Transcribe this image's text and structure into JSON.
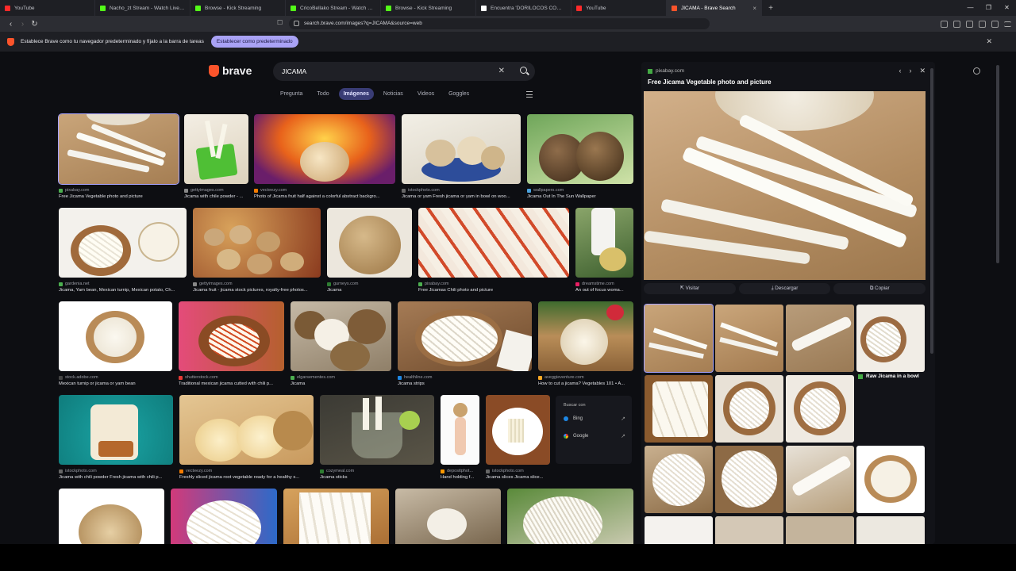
{
  "tabs": [
    {
      "label": "YouTube",
      "color": "#ff2a2a"
    },
    {
      "label": "Nacho_zt Stream - Watch Live on Kick",
      "color": "#53fc18"
    },
    {
      "label": "Browse - Kick Streaming",
      "color": "#53fc18"
    },
    {
      "label": "CricoBellako Stream - Watch Live on Kick",
      "color": "#53fc18"
    },
    {
      "label": "Browse - Kick Streaming",
      "color": "#53fc18"
    },
    {
      "label": "Encuentra 'DORILOCOS COMX' en TikTok",
      "color": "#ffffff"
    },
    {
      "label": "YouTube",
      "color": "#ff2a2a"
    },
    {
      "label": "JICAMA - Brave Search",
      "color": "#fb542b",
      "active": true
    }
  ],
  "url": "search.brave.com/images?q=JICAMA&source=web",
  "infobar": {
    "text": "Establece Brave como tu navegador predeterminado y fíjalo a la barra de tareas",
    "button": "Establecer como predeterminado"
  },
  "brand": "brave",
  "search": {
    "query": "JICAMA"
  },
  "nav": [
    "Pregunta",
    "Todo",
    "Imágenes",
    "Noticias",
    "Videos",
    "Goggles"
  ],
  "nav_selected": "Imágenes",
  "results": [
    {
      "src": "pixabay.com",
      "title": "Free Jicama Vegetable photo and picture",
      "sc": "#4caf50"
    },
    {
      "src": "gettyimages.com",
      "title": "Jicama with chile powder - ...",
      "sc": "#888"
    },
    {
      "src": "vecteezy.com",
      "title": "Photo of Jicama fruit half against a colorful abstract backgro...",
      "sc": "#f57c00"
    },
    {
      "src": "istockphoto.com",
      "title": "Jicama or yam Fresh jicama or yam in bowl on woo...",
      "sc": "#666"
    },
    {
      "src": "wallpapers.com",
      "title": "Jicama Out In The Sun Wallpaper",
      "sc": "#4aa3df"
    },
    {
      "src": "gardenia.net",
      "title": "Jicama, Yam bean, Mexican turnip, Mexican potato, Ch...",
      "sc": "#4caf50"
    },
    {
      "src": "gettyimages.com",
      "title": "Jicama fruit - jicama stock pictures, royalty-free photos...",
      "sc": "#888"
    },
    {
      "src": "gurneys.com",
      "title": "Jicama",
      "sc": "#2e7d32"
    },
    {
      "src": "pixabay.com",
      "title": "Free Jicamas Chili photo and picture",
      "sc": "#4caf50"
    },
    {
      "src": "dreamstime.com",
      "title": "An out of focus woma...",
      "sc": "#e91e63"
    },
    {
      "src": "stock.adobe.com",
      "title": "Mexican turnip or jicama or yam bean",
      "sc": "#444"
    },
    {
      "src": "shutterstock.com",
      "title": "Traditional mexican jicama cutted with chili p...",
      "sc": "#e53935"
    },
    {
      "src": "elgarsementes.com",
      "title": "Jicama",
      "sc": "#4caf50"
    },
    {
      "src": "healthline.com",
      "title": "Jicama strips",
      "sc": "#1e88e5"
    },
    {
      "src": "aveggieventure.com",
      "title": "How to cut a jicama? Vegetables 101 • A...",
      "sc": "#f9a825"
    },
    {
      "src": "istockphoto.com",
      "title": "Jicama with chili powder Fresh jicama with chili p...",
      "sc": "#666"
    },
    {
      "src": "vecteezy.com",
      "title": "Freshly sliced jicama root vegetable ready for a healthy s...",
      "sc": "#f57c00"
    },
    {
      "src": "cozymeal.com",
      "title": "Jicama sticks",
      "sc": "#2e7d32"
    },
    {
      "src": "depositphot...",
      "title": "Hand holding f...",
      "sc": "#ff9800"
    },
    {
      "src": "istockphoto.com",
      "title": "Jicama slices Jicama slice...",
      "sc": "#666"
    }
  ],
  "search_with": {
    "heading": "Buscar con",
    "engines": [
      "Bing",
      "Google"
    ]
  },
  "preview": {
    "source": "pixabay.com",
    "title": "Free Jicama Vegetable photo and picture",
    "actions": [
      "Visitar",
      "Descargar",
      "Copiar"
    ],
    "related_caption": "Raw Jicama in a bowl"
  }
}
